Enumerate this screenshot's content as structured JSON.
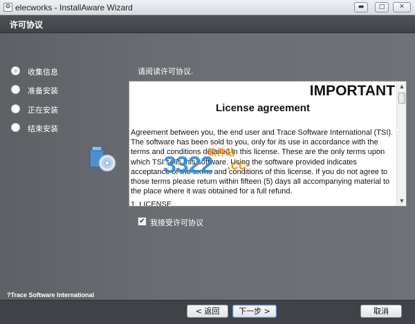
{
  "window": {
    "title": "elecworks - InstallAware Wizard",
    "minimize_glyph": "▬",
    "maximize_glyph": "□",
    "close_glyph": "✕"
  },
  "header": {
    "title": "许可协议"
  },
  "steps": [
    {
      "label": "收集信息",
      "active": true
    },
    {
      "label": "准备安装",
      "active": false
    },
    {
      "label": "正在安装",
      "active": false
    },
    {
      "label": "结束安装",
      "active": false
    }
  ],
  "instruction": "请阅读许可协议.",
  "license": {
    "important": "IMPORTANT",
    "heading": "License agreement",
    "paragraph": "Agreement between you, the end user and Trace Software International (TSI). The software has been sold to you, only for its use in accordance with the terms and conditions detailed in this license. These are the only terms upon which TSI sells this software. Using the software provided indicates acceptance of the terms and conditions of this license. If you do not agree to those terms please return within fifteen (5) days all accompanying material to the place where it was obtained for a full refund.",
    "section": "1. LICENSE"
  },
  "accept": {
    "label": "我接受许可协议",
    "checked": true
  },
  "watermark": {
    "number": "3322",
    "cn": "软件站",
    "tld": ".cc"
  },
  "copyright": "?Trace Software International",
  "buttons": {
    "back": "< 返回",
    "next": "下一步 >",
    "cancel": "取消"
  }
}
